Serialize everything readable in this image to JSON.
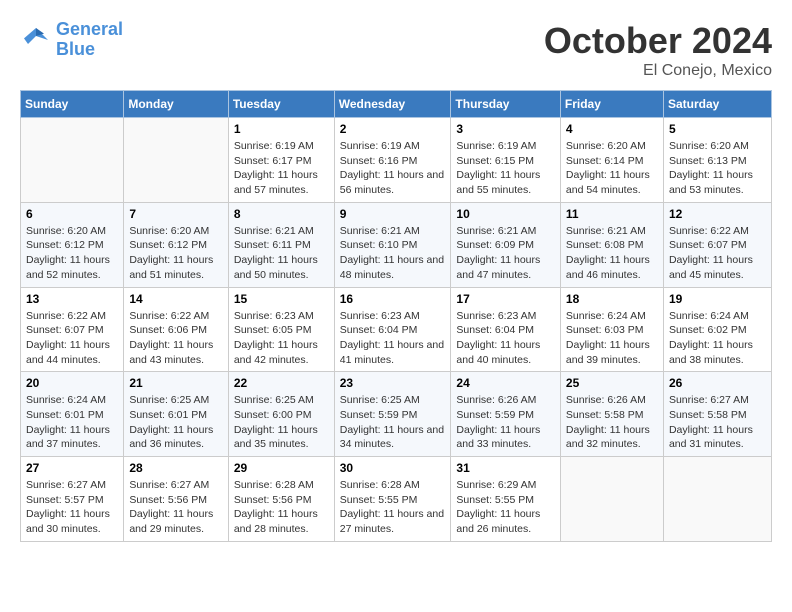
{
  "logo": {
    "line1": "General",
    "line2": "Blue"
  },
  "title": "October 2024",
  "location": "El Conejo, Mexico",
  "days_header": [
    "Sunday",
    "Monday",
    "Tuesday",
    "Wednesday",
    "Thursday",
    "Friday",
    "Saturday"
  ],
  "weeks": [
    [
      {
        "day": "",
        "info": ""
      },
      {
        "day": "",
        "info": ""
      },
      {
        "day": "1",
        "info": "Sunrise: 6:19 AM\nSunset: 6:17 PM\nDaylight: 11 hours and 57 minutes."
      },
      {
        "day": "2",
        "info": "Sunrise: 6:19 AM\nSunset: 6:16 PM\nDaylight: 11 hours and 56 minutes."
      },
      {
        "day": "3",
        "info": "Sunrise: 6:19 AM\nSunset: 6:15 PM\nDaylight: 11 hours and 55 minutes."
      },
      {
        "day": "4",
        "info": "Sunrise: 6:20 AM\nSunset: 6:14 PM\nDaylight: 11 hours and 54 minutes."
      },
      {
        "day": "5",
        "info": "Sunrise: 6:20 AM\nSunset: 6:13 PM\nDaylight: 11 hours and 53 minutes."
      }
    ],
    [
      {
        "day": "6",
        "info": "Sunrise: 6:20 AM\nSunset: 6:12 PM\nDaylight: 11 hours and 52 minutes."
      },
      {
        "day": "7",
        "info": "Sunrise: 6:20 AM\nSunset: 6:12 PM\nDaylight: 11 hours and 51 minutes."
      },
      {
        "day": "8",
        "info": "Sunrise: 6:21 AM\nSunset: 6:11 PM\nDaylight: 11 hours and 50 minutes."
      },
      {
        "day": "9",
        "info": "Sunrise: 6:21 AM\nSunset: 6:10 PM\nDaylight: 11 hours and 48 minutes."
      },
      {
        "day": "10",
        "info": "Sunrise: 6:21 AM\nSunset: 6:09 PM\nDaylight: 11 hours and 47 minutes."
      },
      {
        "day": "11",
        "info": "Sunrise: 6:21 AM\nSunset: 6:08 PM\nDaylight: 11 hours and 46 minutes."
      },
      {
        "day": "12",
        "info": "Sunrise: 6:22 AM\nSunset: 6:07 PM\nDaylight: 11 hours and 45 minutes."
      }
    ],
    [
      {
        "day": "13",
        "info": "Sunrise: 6:22 AM\nSunset: 6:07 PM\nDaylight: 11 hours and 44 minutes."
      },
      {
        "day": "14",
        "info": "Sunrise: 6:22 AM\nSunset: 6:06 PM\nDaylight: 11 hours and 43 minutes."
      },
      {
        "day": "15",
        "info": "Sunrise: 6:23 AM\nSunset: 6:05 PM\nDaylight: 11 hours and 42 minutes."
      },
      {
        "day": "16",
        "info": "Sunrise: 6:23 AM\nSunset: 6:04 PM\nDaylight: 11 hours and 41 minutes."
      },
      {
        "day": "17",
        "info": "Sunrise: 6:23 AM\nSunset: 6:04 PM\nDaylight: 11 hours and 40 minutes."
      },
      {
        "day": "18",
        "info": "Sunrise: 6:24 AM\nSunset: 6:03 PM\nDaylight: 11 hours and 39 minutes."
      },
      {
        "day": "19",
        "info": "Sunrise: 6:24 AM\nSunset: 6:02 PM\nDaylight: 11 hours and 38 minutes."
      }
    ],
    [
      {
        "day": "20",
        "info": "Sunrise: 6:24 AM\nSunset: 6:01 PM\nDaylight: 11 hours and 37 minutes."
      },
      {
        "day": "21",
        "info": "Sunrise: 6:25 AM\nSunset: 6:01 PM\nDaylight: 11 hours and 36 minutes."
      },
      {
        "day": "22",
        "info": "Sunrise: 6:25 AM\nSunset: 6:00 PM\nDaylight: 11 hours and 35 minutes."
      },
      {
        "day": "23",
        "info": "Sunrise: 6:25 AM\nSunset: 5:59 PM\nDaylight: 11 hours and 34 minutes."
      },
      {
        "day": "24",
        "info": "Sunrise: 6:26 AM\nSunset: 5:59 PM\nDaylight: 11 hours and 33 minutes."
      },
      {
        "day": "25",
        "info": "Sunrise: 6:26 AM\nSunset: 5:58 PM\nDaylight: 11 hours and 32 minutes."
      },
      {
        "day": "26",
        "info": "Sunrise: 6:27 AM\nSunset: 5:58 PM\nDaylight: 11 hours and 31 minutes."
      }
    ],
    [
      {
        "day": "27",
        "info": "Sunrise: 6:27 AM\nSunset: 5:57 PM\nDaylight: 11 hours and 30 minutes."
      },
      {
        "day": "28",
        "info": "Sunrise: 6:27 AM\nSunset: 5:56 PM\nDaylight: 11 hours and 29 minutes."
      },
      {
        "day": "29",
        "info": "Sunrise: 6:28 AM\nSunset: 5:56 PM\nDaylight: 11 hours and 28 minutes."
      },
      {
        "day": "30",
        "info": "Sunrise: 6:28 AM\nSunset: 5:55 PM\nDaylight: 11 hours and 27 minutes."
      },
      {
        "day": "31",
        "info": "Sunrise: 6:29 AM\nSunset: 5:55 PM\nDaylight: 11 hours and 26 minutes."
      },
      {
        "day": "",
        "info": ""
      },
      {
        "day": "",
        "info": ""
      }
    ]
  ]
}
